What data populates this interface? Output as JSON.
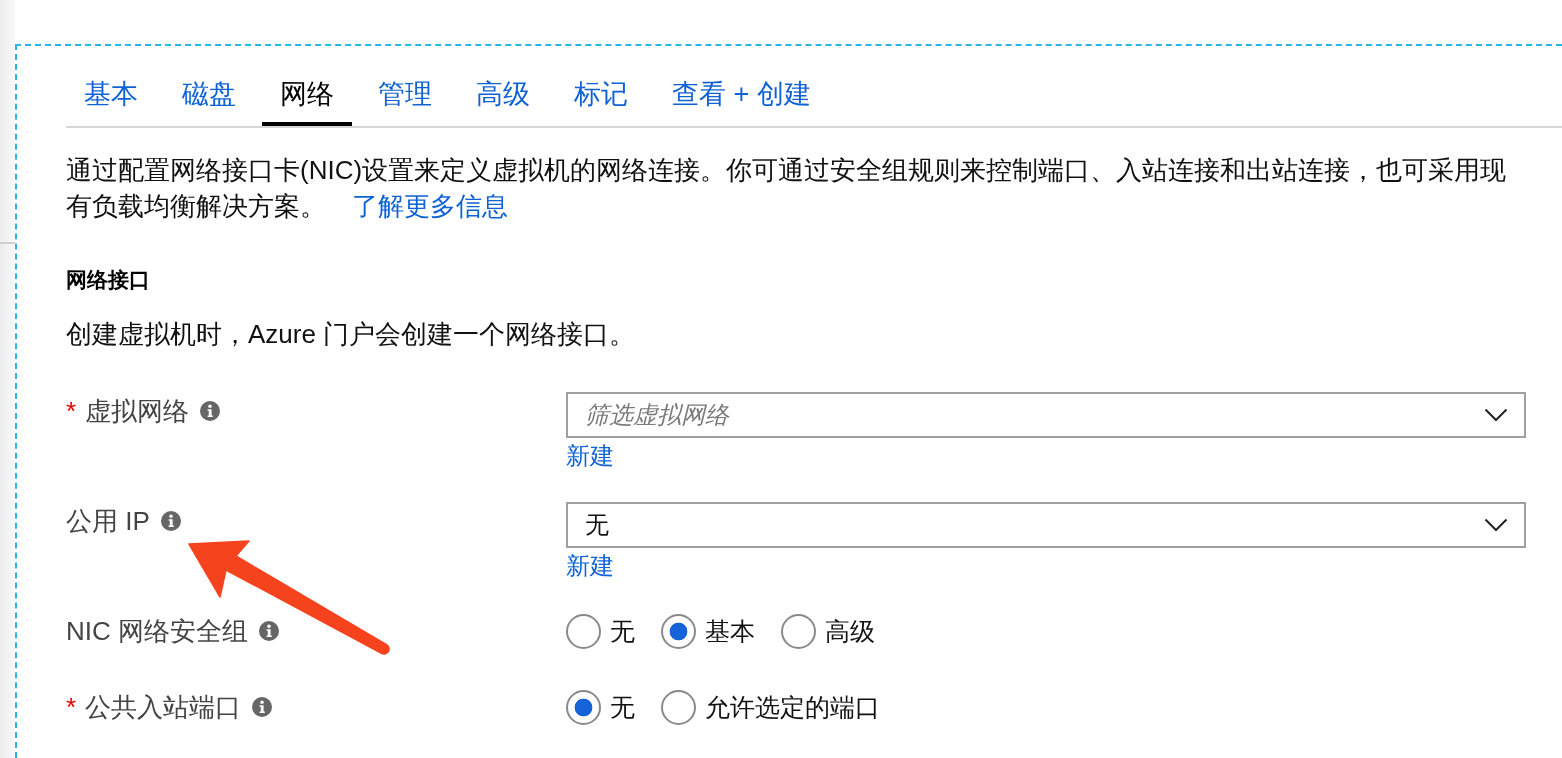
{
  "tabs": [
    {
      "label": "基本",
      "selected": false
    },
    {
      "label": "磁盘",
      "selected": false
    },
    {
      "label": "网络",
      "selected": true
    },
    {
      "label": "管理",
      "selected": false
    },
    {
      "label": "高级",
      "selected": false
    },
    {
      "label": "标记",
      "selected": false
    },
    {
      "label": "查看 + 创建",
      "selected": false
    }
  ],
  "description": {
    "text": "通过配置网络接口卡(NIC)设置来定义虚拟机的网络连接。你可通过安全组规则来控制端口、入站连接和出站连接，也可采用现有负载均衡解决方案。",
    "link": "了解更多信息"
  },
  "section": {
    "heading": "网络接口",
    "text": "创建虚拟机时，Azure 门户会创建一个网络接口。"
  },
  "required_mark": "*",
  "fields": [
    {
      "kind": "dropdown",
      "label": "虚拟网络",
      "required": true,
      "placeholder": "筛选虚拟网络",
      "link": "新建"
    },
    {
      "kind": "dropdown",
      "label": "公用 IP",
      "required": false,
      "value": "无",
      "link": "新建"
    },
    {
      "kind": "radio",
      "label": "NIC 网络安全组",
      "required": false,
      "options": [
        {
          "label": "无",
          "selected": false
        },
        {
          "label": "基本",
          "selected": true
        },
        {
          "label": "高级",
          "selected": false
        }
      ]
    },
    {
      "kind": "radio",
      "label": "公共入站端口",
      "required": true,
      "options": [
        {
          "label": "无",
          "selected": true
        },
        {
          "label": "允许选定的端口",
          "selected": false
        }
      ]
    }
  ],
  "annotations": [
    {
      "kind": "arrow"
    }
  ]
}
